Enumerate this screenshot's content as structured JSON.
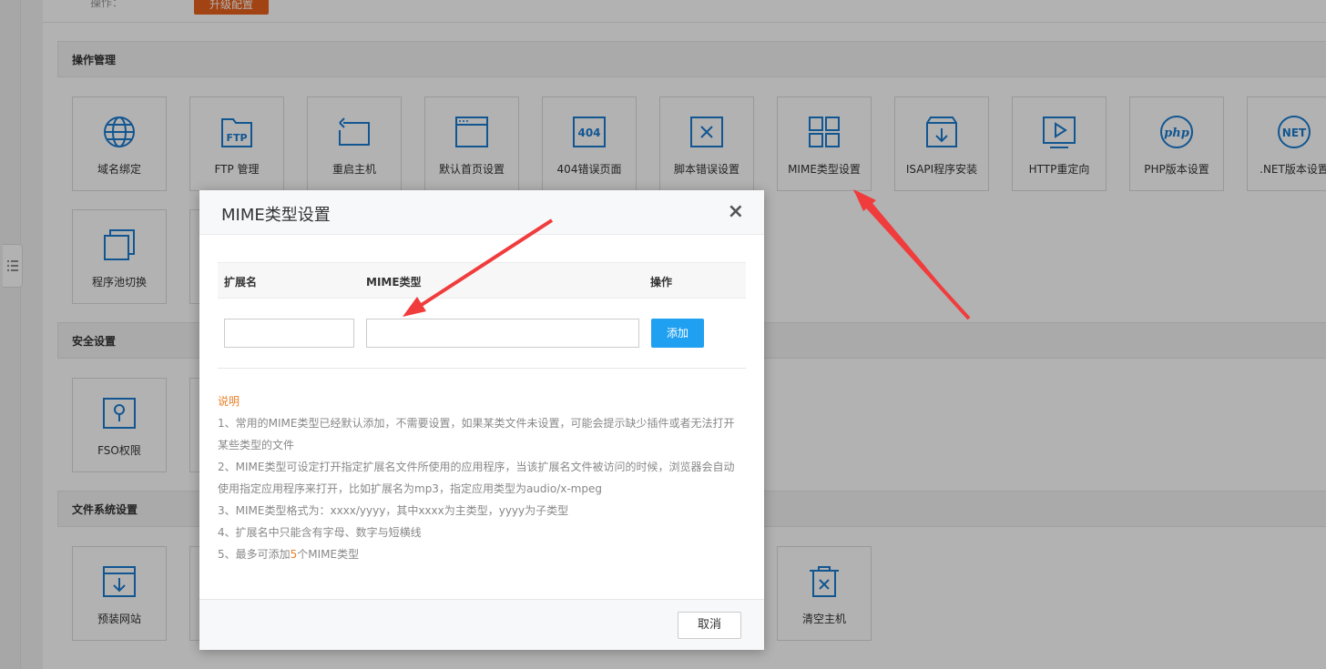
{
  "top": {
    "operate_label": "操作：",
    "upgrade_button": "升级配置"
  },
  "sections": {
    "operation": "操作管理",
    "security": "安全设置",
    "filesystem": "文件系统设置"
  },
  "tiles_row1": [
    {
      "label": "域名绑定",
      "icon": "globe-icon"
    },
    {
      "label": "FTP 管理",
      "icon": "ftp-folder-icon"
    },
    {
      "label": "重启主机",
      "icon": "restart-icon"
    },
    {
      "label": "默认首页设置",
      "icon": "browser-window-icon"
    },
    {
      "label": "404错误页面",
      "icon": "404-icon"
    },
    {
      "label": "脚本错误设置",
      "icon": "script-error-icon"
    },
    {
      "label": "MIME类型设置",
      "icon": "grid-icon"
    },
    {
      "label": "ISAPI程序安装",
      "icon": "install-box-icon"
    },
    {
      "label": "HTTP重定向",
      "icon": "redirect-play-icon"
    },
    {
      "label": "PHP版本设置",
      "icon": "php-icon"
    },
    {
      "label": ".NET版本设置",
      "icon": "dotnet-icon"
    }
  ],
  "tiles_row2": [
    {
      "label": "程序池切换",
      "icon": "app-pool-icon"
    }
  ],
  "tiles_security": [
    {
      "label": "FSO权限",
      "icon": "keyhole-icon"
    }
  ],
  "tiles_filesystem": [
    {
      "label": "预装网站",
      "icon": "preinstall-download-icon"
    },
    {
      "label": "清空主机",
      "icon": "trash-icon"
    }
  ],
  "modal": {
    "title": "MIME类型设置",
    "close_symbol": "×",
    "columns": {
      "ext": "扩展名",
      "mime": "MIME类型",
      "action": "操作"
    },
    "ext_value": "",
    "mime_value": "",
    "add_button": "添加",
    "notes_title": "说明",
    "note1": "1、常用的MIME类型已经默认添加，不需要设置，如果某类文件未设置，可能会提示缺少插件或者无法打开",
    "note1b": "某些类型的文件",
    "note2": "2、MIME类型可设定打开指定扩展名文件所使用的应用程序，当该扩展名文件被访问的时候，浏览器会自动",
    "note2b": "使用指定应用程序来打开，比如扩展名为mp3，指定应用类型为audio/x-mpeg",
    "note3": "3、MIME类型格式为：xxxx/yyyy，其中xxxx为主类型，yyyy为子类型",
    "note4": "4、扩展名中只能含有字母、数字与短横线",
    "note5_pre": "5、最多可添加",
    "note5_num": "5",
    "note5_post": "个MIME类型",
    "cancel_button": "取消"
  },
  "colors": {
    "accent_blue": "#1a7bd0",
    "arrow_red": "#f03c3c",
    "orange": "#e8601c",
    "add_blue": "#20a0f0"
  }
}
